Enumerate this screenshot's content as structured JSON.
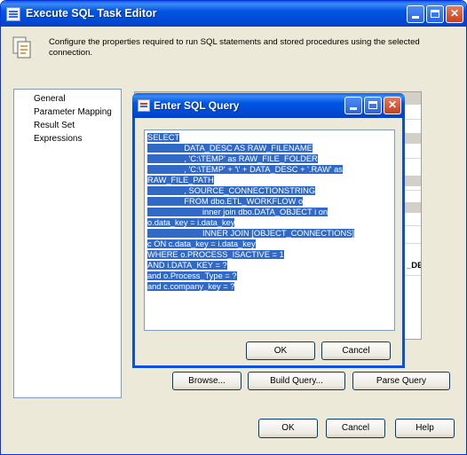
{
  "window": {
    "title": "Execute SQL Task Editor",
    "header_text": "Configure the properties required to run SQL statements and stored procedures using the selected connection."
  },
  "nav": {
    "items": [
      {
        "label": "General"
      },
      {
        "label": "Parameter Mapping"
      },
      {
        "label": "Result Set"
      },
      {
        "label": "Expressions"
      }
    ]
  },
  "background_peek_text": "_DESC AS R",
  "buttons": {
    "browse": "Browse...",
    "build_query": "Build Query...",
    "parse_query": "Parse Query",
    "ok": "OK",
    "cancel": "Cancel",
    "help": "Help"
  },
  "dialog": {
    "title": "Enter SQL Query",
    "ok": "OK",
    "cancel": "Cancel",
    "sql_lines": [
      "SELECT",
      "                DATA_DESC AS RAW_FILENAME",
      "                , 'C:\\TEMP' as RAW_FILE_FOLDER",
      "                , 'C:\\TEMP' + '\\' + DATA_DESC + '.RAW' as",
      "RAW_FILE_PATH",
      "                , SOURCE_CONNECTIONSTRING",
      "                FROM dbo.ETL_WORKFLOW o",
      "                        inner join dbo.DATA_OBJECT i on",
      "o.data_key = i.data_key",
      "                        INNER JOIN [OBJECT_CONNECTIONS]",
      "c ON c.data_key = i.data_key",
      "WHERE o.PROCESS_ISACTIVE = 1",
      "AND i.DATA_KEY = ?",
      "and o.Process_Type = ?",
      "and c.company_key = ?"
    ]
  }
}
